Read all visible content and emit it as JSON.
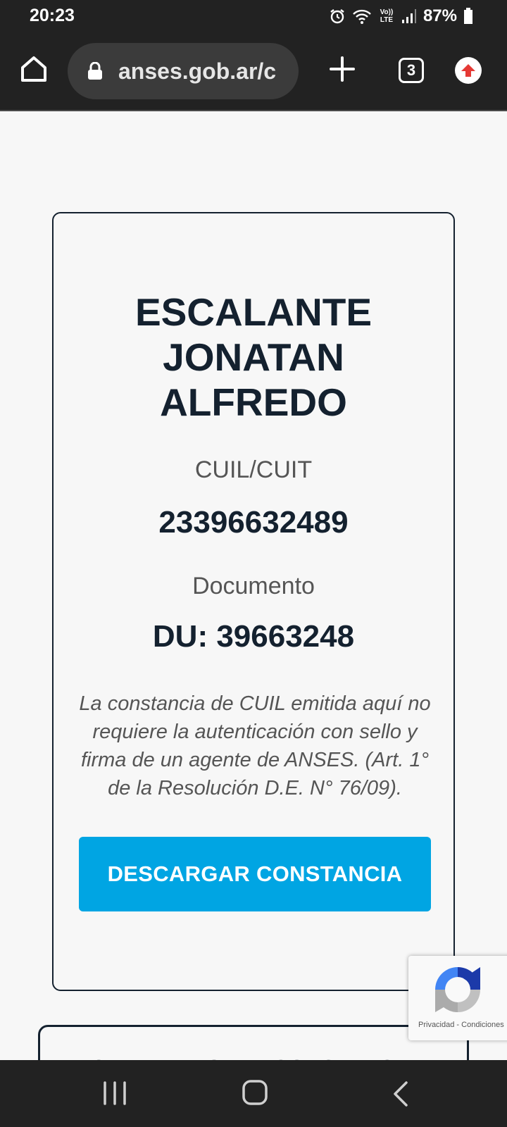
{
  "status_bar": {
    "time": "20:23",
    "network_label": "Vo)) LTE",
    "battery": "87%",
    "icons": [
      "alarm-icon",
      "wifi-icon",
      "volte-icon",
      "signal-icon",
      "battery-icon"
    ]
  },
  "browser": {
    "url": "anses.gob.ar/c",
    "tab_count": "3",
    "icons": [
      "home-icon",
      "lock-icon",
      "plus-icon",
      "tabs-icon",
      "update-icon"
    ]
  },
  "card": {
    "name": "ESCALANTE JONATAN ALFREDO",
    "cuil_label": "CUIL/CUIT",
    "cuil_value": "23396632489",
    "doc_label": "Documento",
    "doc_value": "DU: 39663248",
    "disclaimer": "La constancia de CUIL emitida aquí no requiere la autenticación con sello y firma de un agente de ANSES. (Art. 1° de la Resolución D.E. N° 76/09).",
    "download_button": "DESCARGAR CONSTANCIA"
  },
  "second_card": {
    "button": "GENERAR OTRA CONSTANCIA"
  },
  "recaptcha": {
    "privacy": "Privacidad",
    "separator": "-",
    "terms": "Condiciones"
  },
  "nav_bar": {
    "icons": [
      "recent-apps-icon",
      "home-nav-icon",
      "back-icon"
    ]
  },
  "colors": {
    "accent": "#00a5e3",
    "text_dark": "#14212f",
    "text_muted": "#555555",
    "chrome_bg": "#222222",
    "page_bg": "#f7f7f7"
  }
}
